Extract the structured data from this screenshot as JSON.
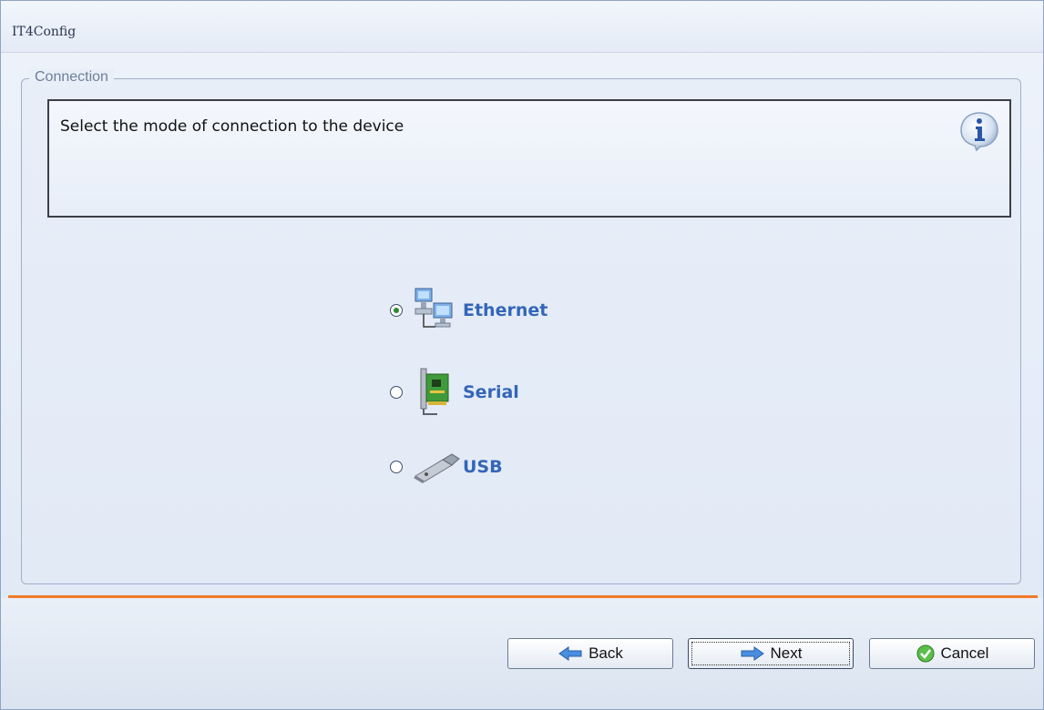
{
  "window": {
    "title": "IT4Config"
  },
  "group": {
    "legend": "Connection"
  },
  "info": {
    "text": "Select the mode of connection to the device",
    "icon": "info-icon"
  },
  "options": [
    {
      "label": "Ethernet",
      "icon": "network-computers-icon",
      "selected": true
    },
    {
      "label": "Serial",
      "icon": "serial-card-icon",
      "selected": false
    },
    {
      "label": "USB",
      "icon": "usb-drive-icon",
      "selected": false
    }
  ],
  "buttons": {
    "back": "Back",
    "next": "Next",
    "cancel": "Cancel"
  },
  "colors": {
    "accent_separator": "#f07a2a",
    "option_label": "#3466b8"
  }
}
